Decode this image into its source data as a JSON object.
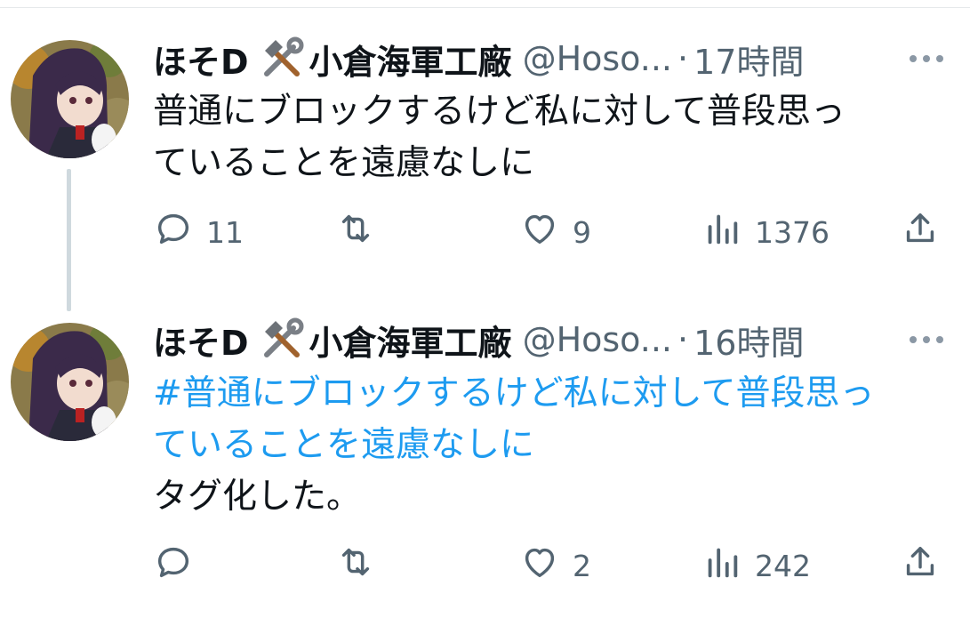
{
  "tweets": [
    {
      "author_name": "ほそD",
      "org_name": "小倉海軍工廠",
      "handle": "@Hoso...",
      "separator": "·",
      "time": "17時間",
      "hashtag_text": "",
      "text_lines": [
        "普通にブロックするけど私に対して普段思っ",
        "ていることを遠慮なしに"
      ],
      "counts": {
        "replies": "11",
        "retweets": "",
        "likes": "9",
        "views": "1376"
      }
    },
    {
      "author_name": "ほそD",
      "org_name": "小倉海軍工廠",
      "handle": "@Hoso...",
      "separator": "·",
      "time": "16時間",
      "hashtag_lines": [
        "#普通にブロックするけど私に対して普段思っ",
        "ていることを遠慮なしに"
      ],
      "text": "タグ化した。",
      "counts": {
        "replies": "",
        "retweets": "",
        "likes": "2",
        "views": "242"
      }
    }
  ],
  "icons": [
    "reply-icon",
    "retweet-icon",
    "like-icon",
    "views-icon",
    "share-icon",
    "more-icon",
    "hammer-wrench-icon"
  ],
  "colors": {
    "text": "#0f1419",
    "secondary": "#536471",
    "hashtag": "#1d9bf0",
    "thread_line": "#cfd9de"
  }
}
